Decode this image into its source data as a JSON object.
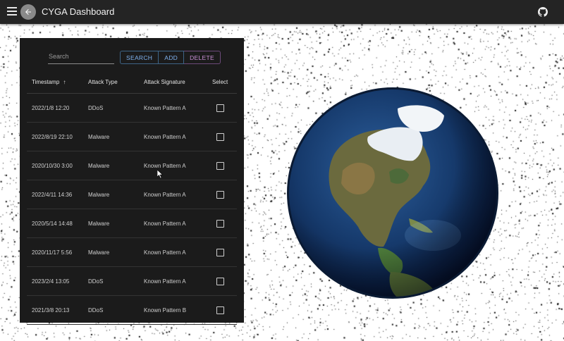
{
  "app": {
    "title": "CYGA Dashboard"
  },
  "icons": {
    "menu": "menu-icon",
    "back": "arrow-back-icon",
    "github": "github-icon",
    "sort": "arrow-up-icon",
    "checkbox": "checkbox-unchecked-icon"
  },
  "toolbar": {
    "search_placeholder": "Search",
    "search_label": "SEARCH",
    "add_label": "ADD",
    "delete_label": "DELETE"
  },
  "table": {
    "columns": {
      "timestamp": "Timestamp",
      "attack_type": "Attack Type",
      "attack_signature": "Attack Signature",
      "select": "Select"
    },
    "sort_indicator": "↑",
    "rows": [
      {
        "timestamp": "2022/1/8 12:20",
        "attack_type": "DDoS",
        "signature": "Known Pattern A",
        "selected": false
      },
      {
        "timestamp": "2022/8/19 22:10",
        "attack_type": "Malware",
        "signature": "Known Pattern A",
        "selected": false
      },
      {
        "timestamp": "2020/10/30 3:00",
        "attack_type": "Malware",
        "signature": "Known Pattern A",
        "selected": false
      },
      {
        "timestamp": "2022/4/11 14:36",
        "attack_type": "Malware",
        "signature": "Known Pattern A",
        "selected": false
      },
      {
        "timestamp": "2020/5/14 14:48",
        "attack_type": "Malware",
        "signature": "Known Pattern A",
        "selected": false
      },
      {
        "timestamp": "2020/11/17 5:56",
        "attack_type": "Malware",
        "signature": "Known Pattern A",
        "selected": false
      },
      {
        "timestamp": "2023/2/4 13:05",
        "attack_type": "DDoS",
        "signature": "Known Pattern A",
        "selected": false
      },
      {
        "timestamp": "2021/3/8 20:13",
        "attack_type": "DDoS",
        "signature": "Known Pattern B",
        "selected": false
      }
    ]
  },
  "colors": {
    "appbar": "#242424",
    "panel": "#1b1b1b",
    "primary": "#7fb2ee",
    "secondary": "#c98fd6"
  }
}
